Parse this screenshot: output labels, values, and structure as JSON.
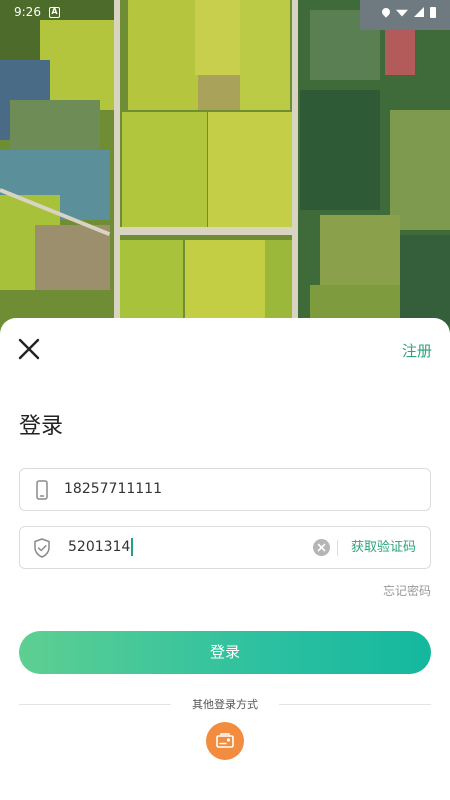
{
  "status_bar": {
    "time": "9:26"
  },
  "header": {
    "register_label": "注册"
  },
  "page": {
    "title": "登录"
  },
  "form": {
    "phone_value": "18257711111",
    "code_value": "5201314",
    "get_code_label": "获取验证码",
    "forgot_label": "忘记密码"
  },
  "actions": {
    "login_label": "登录",
    "other_methods_label": "其他登录方式"
  },
  "colors": {
    "accent": "#2ea37a",
    "button_gradient_start": "#5ecf92",
    "button_gradient_end": "#14b89f",
    "alt_login_bg": "#f28c3e"
  },
  "icons": {
    "close": "close-icon",
    "phone": "phone-icon",
    "shield": "shield-check-icon",
    "clear": "clear-icon",
    "alt_login": "id-card-icon"
  }
}
